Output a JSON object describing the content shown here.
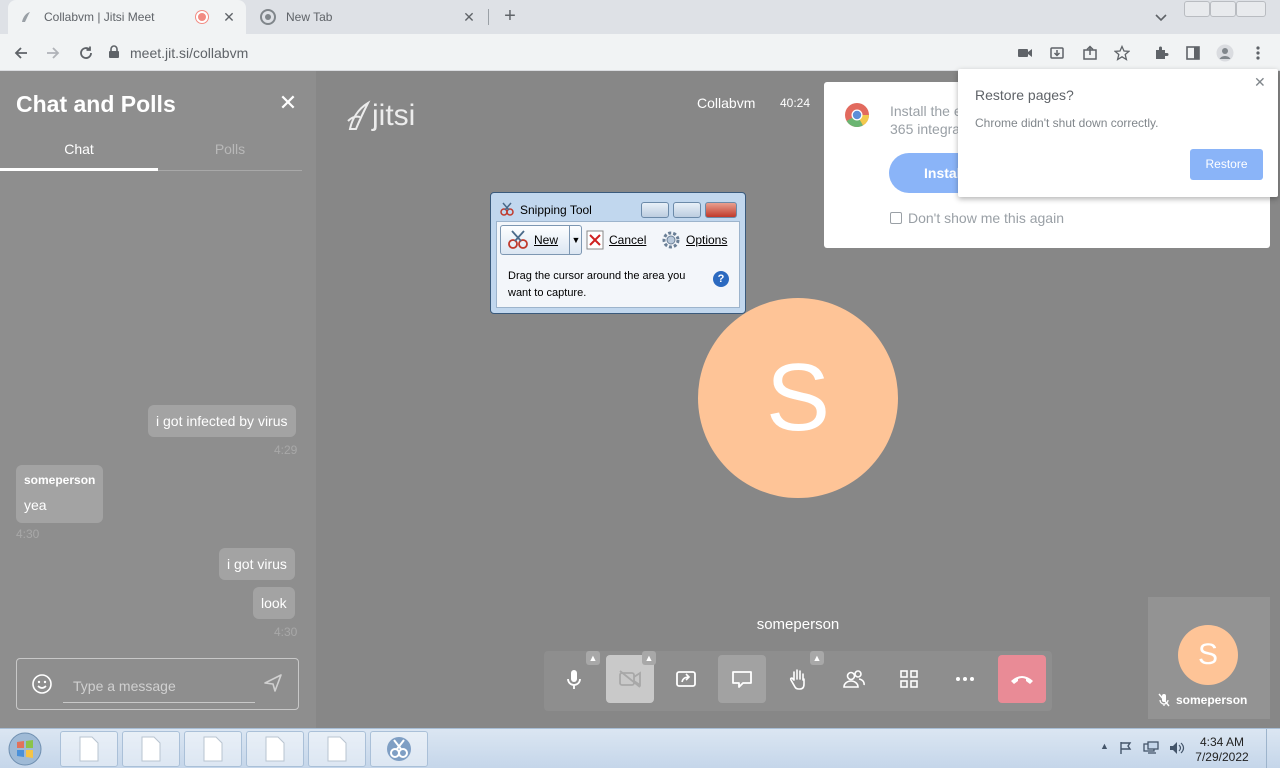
{
  "browser": {
    "tabs": [
      {
        "title": "Collabvm | Jitsi Meet",
        "active": true
      },
      {
        "title": "New Tab",
        "active": false
      }
    ],
    "url": "meet.jit.si/collabvm"
  },
  "chat": {
    "title": "Chat and Polls",
    "tabs": [
      "Chat",
      "Polls"
    ],
    "messages": [
      {
        "text": "i got infected by virus",
        "time": "4:29",
        "own": true
      },
      {
        "sender": "someperson",
        "text": "yea",
        "time": "4:30",
        "own": false
      },
      {
        "text": "i got virus",
        "own": true
      },
      {
        "text": "look",
        "time": "4:30",
        "own": true
      }
    ],
    "input_placeholder": "Type a message"
  },
  "meeting": {
    "logo": "jitsi",
    "name": "Collabvm",
    "timer": "40:24",
    "participant_initial": "S",
    "participant_name": "someperson",
    "thumbnail": {
      "initial": "S",
      "name": "someperson"
    }
  },
  "install_banner": {
    "text_line1": "Install the e",
    "text_line2": "365 integra",
    "button": "Instal",
    "checkbox_label": "Don't show me this again"
  },
  "restore_popup": {
    "title": "Restore pages?",
    "message": "Chrome didn't shut down correctly.",
    "button": "Restore"
  },
  "snipping_tool": {
    "title": "Snipping Tool",
    "new_label": "New",
    "cancel_label": "Cancel",
    "options_label": "Options",
    "hint": "Drag the cursor around the area you want to capture."
  },
  "taskbar": {
    "time": "4:34 AM",
    "date": "7/29/2022"
  },
  "colors": {
    "avatar": "#fec497",
    "hangup": "#e98b96",
    "accent_button": "#8ab4f8"
  }
}
